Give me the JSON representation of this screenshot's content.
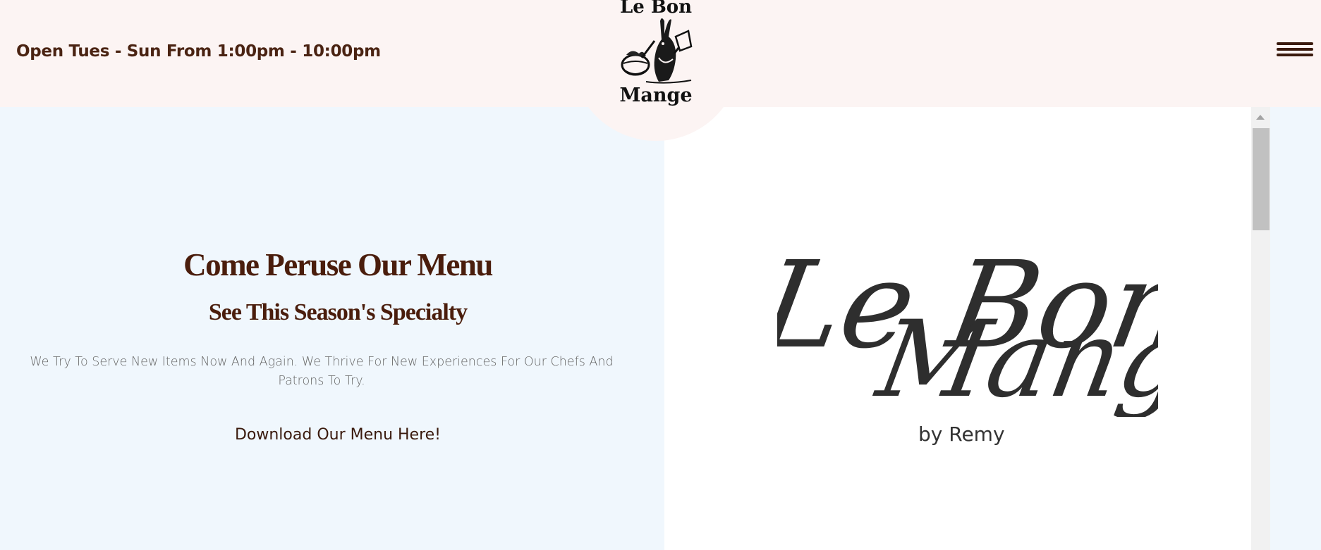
{
  "header": {
    "hours": "Open Tues - Sun From 1:00pm - 10:00pm",
    "logo_top": "Le Bon",
    "logo_bottom": "Mange",
    "menu_icon": "hamburger-icon",
    "background": "#fcf4f3"
  },
  "menu_section": {
    "title": "Come Peruse Our Menu",
    "subtitle": "See This Season's Specialty",
    "description": "We Try To Serve New Items Now And Again. We Thrive For New Experiences For Our Chefs And Patrons To Try.",
    "download_label": "Download Our Menu Here!",
    "background": "#f0f7fd",
    "text_color": "#4a1d0c"
  },
  "menu_preview": {
    "script_title_line1": "Le Bon",
    "script_title_line2": "Mange",
    "byline": "by Remy"
  }
}
